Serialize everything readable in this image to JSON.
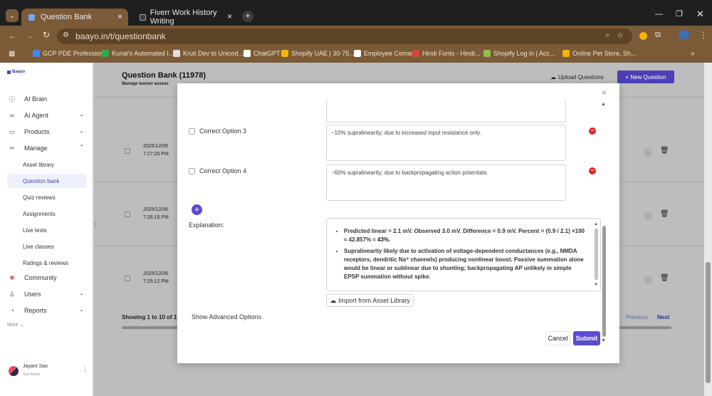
{
  "browser": {
    "tabs": [
      {
        "title": "Question Bank",
        "active": true
      },
      {
        "title": "Fiverr Work History Writing",
        "active": false
      }
    ],
    "new_tab_symbol": "+",
    "url": "baayo.in/t/questionbank",
    "bookmarks": [
      {
        "label": "GCP PDE Profession...",
        "color": "#4285f4"
      },
      {
        "label": "Kunal's Automated I...",
        "color": "#34a853"
      },
      {
        "label": "Kruti Dev to Unicod...",
        "color": "#e0e0e0"
      },
      {
        "label": "ChatGPT",
        "color": "#ffffff"
      },
      {
        "label": "Shopify UAE | 30-75...",
        "color": "#f4b400"
      },
      {
        "label": "Employee Corner",
        "color": "#ffffff"
      },
      {
        "label": "Hindi Fonts - Hindi...",
        "color": "#db4437"
      },
      {
        "label": "Shopify Log in | Acc...",
        "color": "#95bf47"
      },
      {
        "label": "Online Pet Store, Sh...",
        "color": "#f4b400"
      }
    ]
  },
  "sidebar": {
    "logo": "Baayo",
    "items": [
      {
        "label": "AI Brain",
        "icon": "brain-icon",
        "chevron": ""
      },
      {
        "label": "AI Agent",
        "icon": "agent-icon",
        "chevron": "⌄"
      },
      {
        "label": "Products",
        "icon": "products-icon",
        "chevron": "⌄"
      },
      {
        "label": "Manage",
        "icon": "tools-icon",
        "chevron": "⌃"
      }
    ],
    "subitems": [
      "Asset library",
      "Question bank",
      "Quiz reviews",
      "Assignments",
      "Live tests",
      "Live classes",
      "Ratings & reviews"
    ],
    "items_bottom": [
      {
        "label": "Community",
        "icon": "community-icon",
        "chevron": ""
      },
      {
        "label": "Users",
        "icon": "user-icon",
        "chevron": "⌄"
      },
      {
        "label": "Reports",
        "icon": "reports-icon",
        "chevron": "⌄"
      }
    ],
    "more": "More",
    "user": {
      "name": "Jayant Sao",
      "role": "Sub Admin"
    }
  },
  "page": {
    "title": "Question Bank (11978)",
    "subtitle": "Manage learner assess",
    "upload_label": "Upload Questions",
    "new_question_label": "+ New Question",
    "rows": [
      {
        "date": "2025/12/06",
        "time": "7:27:20 PM"
      },
      {
        "date": "2025/12/06",
        "time": "7:26:15 PM"
      },
      {
        "date": "2025/12/06",
        "time": "7:25:12 PM"
      }
    ],
    "showing": "Showing 1 to 10 of 1",
    "previous": "Previous",
    "next": "Next"
  },
  "modal": {
    "close": "×",
    "options": [
      {
        "label": "Correct Option 3",
        "text": "~10% supralinearity; due to increased input resistance only."
      },
      {
        "label": "Correct Option 4",
        "text": "~60% supralinearity; due to backpropagating action potentials."
      }
    ],
    "add_symbol": "+",
    "explanation_label": "Explanation:",
    "explanation_bullets": [
      {
        "text": "Predicted linear = 2.1 mV. Observed 3.0 mV. Difference = 0.9 mV. Percent = (0.9 / 2.1) ×100 ≈ 42.857% ≈ ",
        "bold": "43%."
      },
      {
        "text": "Supralinearity likely due to activation of voltage-dependent conductances (e.g., NMDA receptors, dendritic Na⁺ channels) producing nonlinear boost. Passive summation alone would be linear or sublinear due to shunting; backpropagating AP unlikely in simple EPSP summation without spike.",
        "bold": ""
      }
    ],
    "import_label": "Import from Asset Library",
    "advanced_label": "Show Advanced Options",
    "cancel_label": "Cancel",
    "submit_label": "Submit"
  },
  "colors": {
    "accent": "#5b4bd5",
    "browser": "#7a5a37",
    "danger": "#e02424"
  }
}
